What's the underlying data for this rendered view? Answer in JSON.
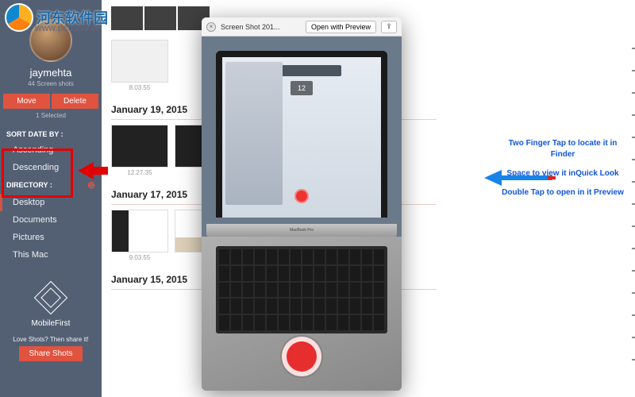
{
  "watermark": {
    "title": "河东软件园",
    "url": "www.pc0359.cn"
  },
  "sidebar": {
    "username": "jaymehta",
    "subtitle": "44 Screen shots",
    "move": "Move",
    "delete": "Delete",
    "selected": "1 Selected",
    "sort_label": "SORT DATE BY :",
    "sort_asc": "Ascending",
    "sort_desc": "Descending",
    "dir_label": "DIRECTORY :",
    "dirs": [
      "Desktop",
      "Documents",
      "Pictures",
      "This Mac"
    ],
    "logo": "MobileFirst",
    "love": "Love Shots? Then share it!",
    "share": "Share Shots"
  },
  "dates": {
    "d1": "January 19, 2015",
    "d2": "January 17, 2015",
    "d3": "January 15, 2015"
  },
  "caps": {
    "c1": "8.03.55",
    "c2": "12.27.35",
    "c3": "9.03.55"
  },
  "ql": {
    "title": "Screen Shot 201...",
    "open": "Open with Preview",
    "hinge": "MacBook Pro",
    "counter": "12"
  },
  "tips": {
    "t1": "Two Finger Tap to locate it in Finder",
    "t2": "Space to view it inQuick Look",
    "t3": "Double Tap to open in it Preview"
  }
}
